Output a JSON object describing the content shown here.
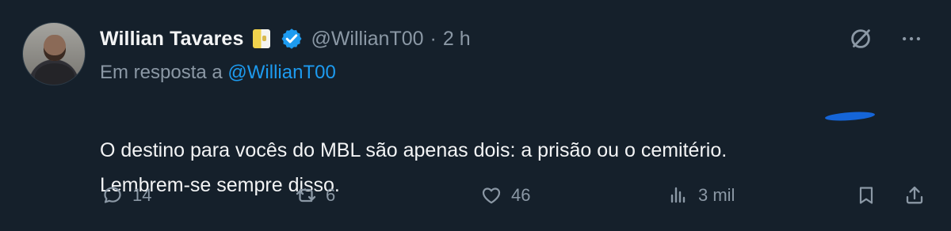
{
  "author": {
    "display_name": "Willian Tavares",
    "handle": "@WillianT00",
    "separator": "·",
    "time": "2 h"
  },
  "reply_context": {
    "prefix": "Em resposta a",
    "mention": "@WillianT00"
  },
  "post": {
    "text": "O destino para vocês do MBL são apenas dois: a prisão ou o cemitério.\nLembrem-se sempre disso."
  },
  "metrics": {
    "replies": "14",
    "retweets": "6",
    "likes": "46",
    "views": "3 mil"
  },
  "icons": {
    "badge": "verified-icon",
    "flag": "flag-badge",
    "grok": "grok-icon",
    "more": "more-icon",
    "reply": "reply-icon",
    "retweet": "retweet-icon",
    "like": "heart-icon",
    "views": "views-icon",
    "bookmark": "bookmark-icon",
    "share": "share-icon"
  },
  "colors": {
    "background": "#15202b",
    "text": "#f3f4f5",
    "secondary": "#8b98a5",
    "accent": "#1d9bf0"
  }
}
